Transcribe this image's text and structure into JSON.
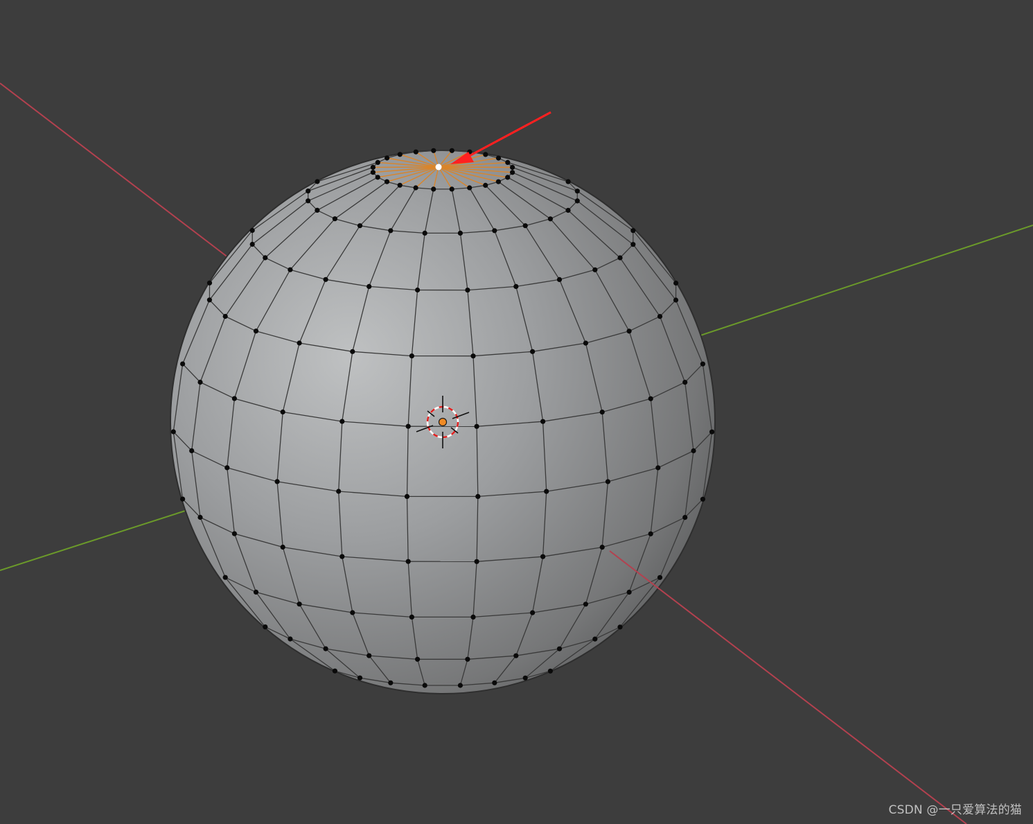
{
  "viewport": {
    "background": "#3d3d3d",
    "x_axis_color": "#b3414f",
    "y_axis_color": "#6b9a2a",
    "mesh_face_color": "#9a9c9e",
    "mesh_edge_color": "#3a3a3a",
    "vertex_color": "#0a0a0a",
    "selected_vertex_color": "#ffffff",
    "selected_edge_color": "#d9852b",
    "arrow_color": "#ff2020",
    "origin_color": "#f08a24"
  },
  "mesh": {
    "type": "uv-sphere",
    "segments": 24,
    "rings": 12,
    "selected_element": "top-pole-vertex"
  },
  "icons": {
    "cursor": "3d-cursor-icon",
    "origin": "object-origin-icon",
    "annotation": "red-arrow-annotation"
  },
  "watermark": "CSDN @一只爱算法的猫"
}
